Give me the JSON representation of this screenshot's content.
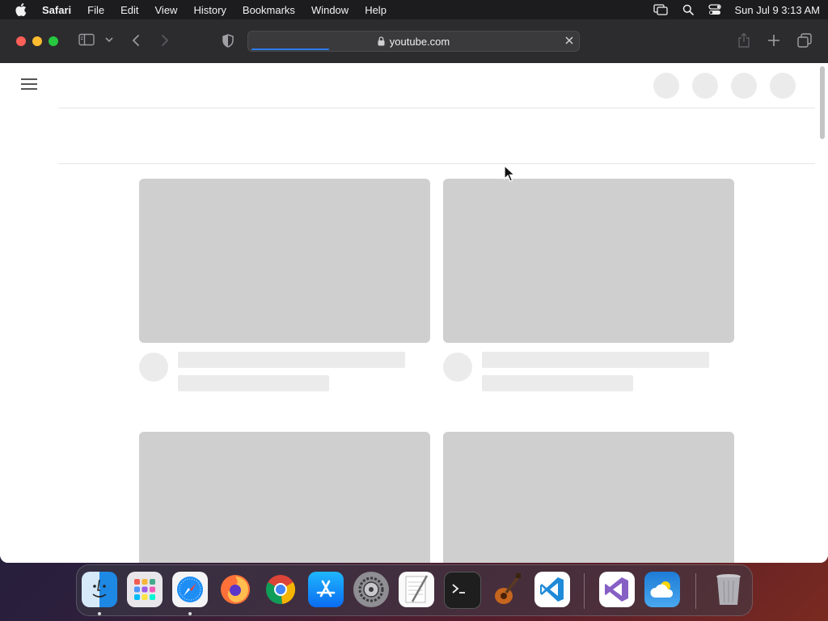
{
  "menubar": {
    "app_name": "Safari",
    "items": [
      "File",
      "Edit",
      "View",
      "History",
      "Bookmarks",
      "Window",
      "Help"
    ],
    "clock": "Sun Jul 9  3:13 AM",
    "icons": [
      "apple-icon",
      "screen-mirroring-icon",
      "spotlight-search-icon",
      "control-center-icon"
    ]
  },
  "browser": {
    "url": "youtube.com",
    "load_progress": 0.24,
    "toolbar_icons": [
      "sidebar-icon",
      "chevron-down-icon",
      "back-icon",
      "forward-icon",
      "privacy-shield-icon",
      "lock-icon",
      "clear-icon",
      "share-icon",
      "new-tab-icon",
      "tab-overview-icon"
    ]
  },
  "page": {
    "state": "loading-skeleton",
    "placeholders": "skeleton"
  },
  "dock": {
    "apps": [
      "finder",
      "launchpad",
      "safari",
      "firefox",
      "chrome",
      "app-store",
      "system-settings",
      "textedit",
      "terminal",
      "garageband",
      "vscode",
      "visual-studio",
      "weather",
      "trash"
    ],
    "running": [
      "finder",
      "safari"
    ]
  },
  "colors": {
    "accent": "#2e7cf6",
    "skeleton_thumb": "#cfcfcf",
    "skeleton_line": "#ebebeb",
    "close": "#fe5f57",
    "minimize": "#febc2e",
    "maximize": "#28c840"
  }
}
